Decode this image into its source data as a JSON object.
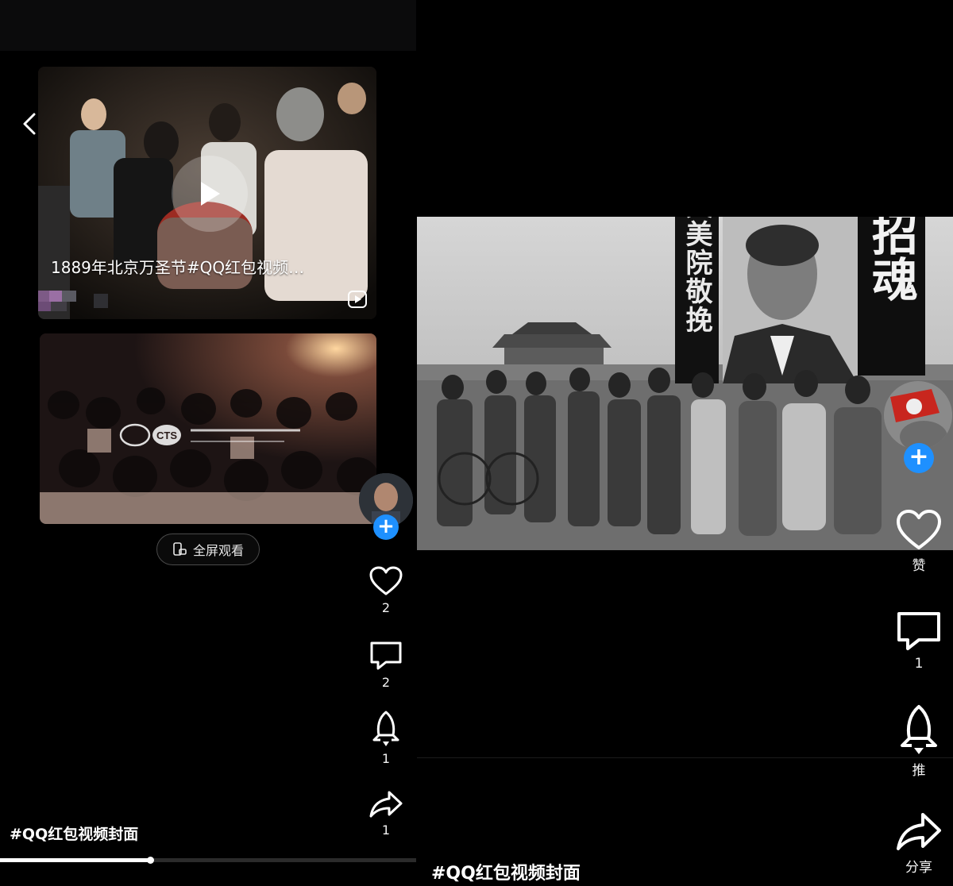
{
  "left_panel": {
    "card1": {
      "title": "1889年北京万圣节#QQ红包视频…"
    },
    "fullscreen_label": "全屏观看",
    "rail": {
      "like_count": "2",
      "comment_count": "2",
      "boost_count": "1",
      "share_count": "1"
    },
    "hashtag": "#QQ红包视频封面",
    "progress_fraction": 0.36
  },
  "right_panel": {
    "banner_left_text": "中央美院敬挽",
    "banner_right_text": "处招魂",
    "rail": {
      "like_label": "赞",
      "comment_count": "1",
      "boost_label": "推",
      "share_label": "分享"
    },
    "hashtag": "#QQ红包视频封面"
  },
  "icons": [
    "back-icon",
    "play-icon",
    "video-badge-icon",
    "phone-rotate-icon",
    "heart-icon",
    "comment-icon",
    "rocket-icon",
    "share-icon",
    "plus-icon"
  ],
  "colors": {
    "accent": "#1e90ff",
    "background": "#000000"
  }
}
